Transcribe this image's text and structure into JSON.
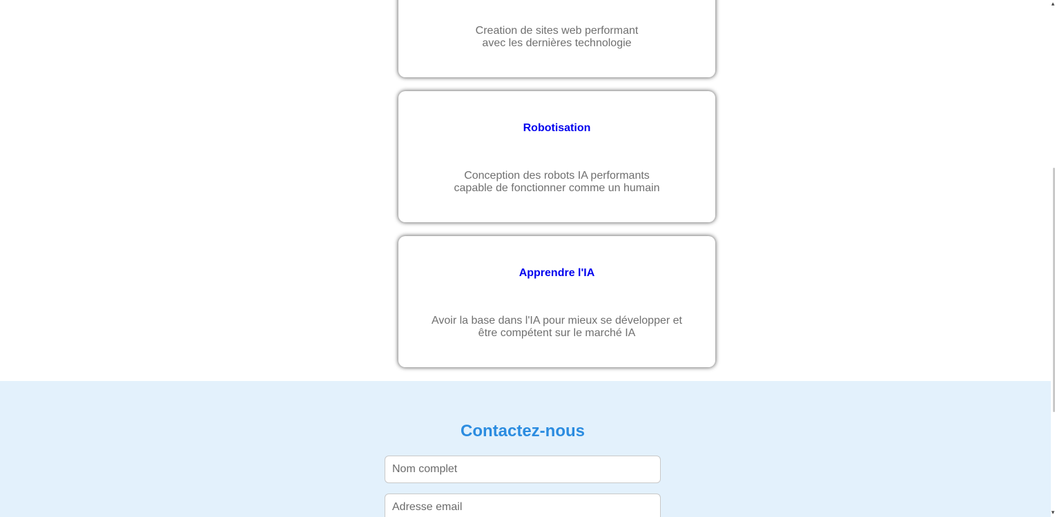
{
  "services": [
    {
      "title": "",
      "description_lines": [
        "Creation de sites web performant",
        "avec les dernières technologie"
      ]
    },
    {
      "title": "Robotisation",
      "description_lines": [
        "Conception des robots IA performants",
        "capable de fonctionner comme un humain"
      ]
    },
    {
      "title": "Apprendre l'IA",
      "description_lines": [
        "Avoir la base dans l'IA pour mieux se développer et",
        "être compétent sur le marché IA"
      ]
    }
  ],
  "contact": {
    "title": "Contactez-nous",
    "name_placeholder": "Nom complet",
    "email_placeholder": "Adresse email"
  },
  "colors": {
    "card_title": "#0000ee",
    "card_text": "#6f6f6f",
    "contact_bg": "#e3f1fc",
    "contact_title": "#2b8ce0"
  },
  "icons": {
    "scroll_up": "chevron-up-icon",
    "scroll_down": "chevron-down-icon"
  }
}
